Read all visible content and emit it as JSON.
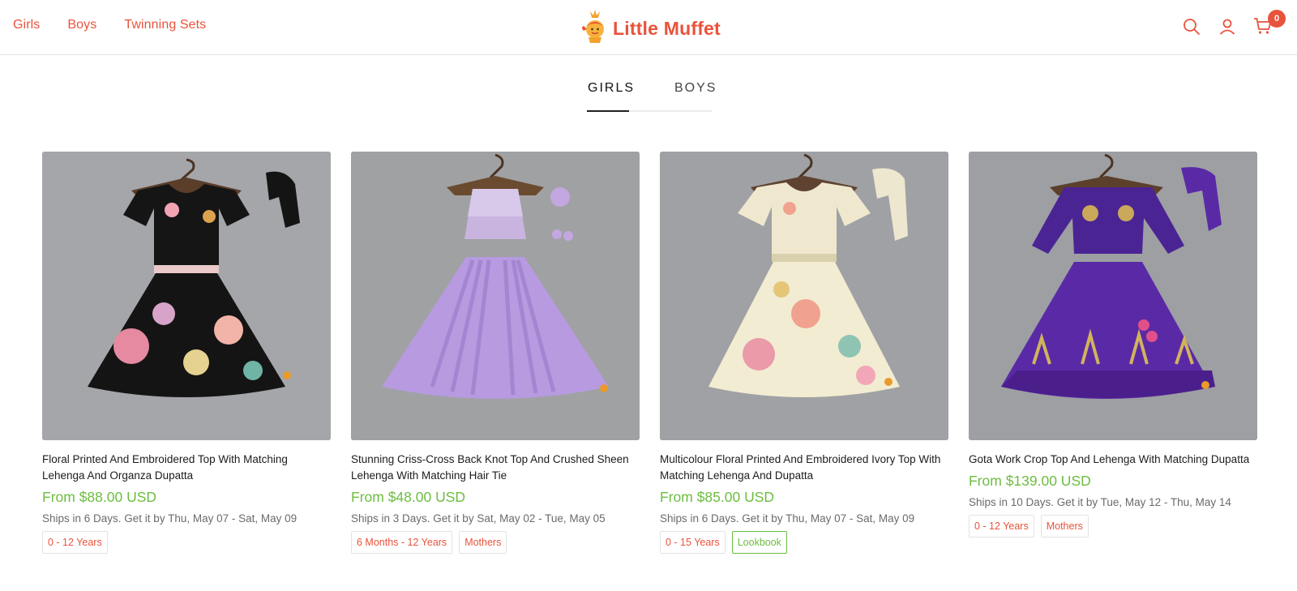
{
  "header": {
    "nav": [
      "Girls",
      "Boys",
      "Twinning Sets"
    ],
    "logo_text": "Little Muffet",
    "cart_count": "0"
  },
  "tabs": [
    {
      "label": "GIRLS",
      "active": true
    },
    {
      "label": "BOYS",
      "active": false
    }
  ],
  "colors": {
    "brand": "#e8533c",
    "price": "#6cbd3f"
  },
  "products": [
    {
      "title": "Floral Printed And Embroidered Top With Matching Lehenga And Organza Dupatta",
      "price": "From $88.00 USD",
      "shipping": "Ships in 6 Days. Get it by Thu, May 07 - Sat, May 09",
      "tags": [
        {
          "label": "0 - 12 Years",
          "style": "orange"
        }
      ]
    },
    {
      "title": "Stunning Criss-Cross Back Knot Top And Crushed Sheen Lehenga With Matching Hair Tie",
      "price": "From $48.00 USD",
      "shipping": "Ships in 3 Days. Get it by Sat, May 02 - Tue, May 05",
      "tags": [
        {
          "label": "6 Months - 12 Years",
          "style": "orange"
        },
        {
          "label": "Mothers",
          "style": "orange"
        }
      ]
    },
    {
      "title": "Multicolour Floral Printed And Embroidered Ivory Top With Matching Lehenga And Dupatta",
      "price": "From $85.00 USD",
      "shipping": "Ships in 6 Days. Get it by Thu, May 07 - Sat, May 09",
      "tags": [
        {
          "label": "0 - 15 Years",
          "style": "orange"
        },
        {
          "label": "Lookbook",
          "style": "green"
        }
      ]
    },
    {
      "title": "Gota Work Crop Top And Lehenga With Matching Dupatta",
      "price": "From $139.00 USD",
      "shipping": "Ships in 10 Days. Get it by Tue, May 12 - Thu, May 14",
      "tags": [
        {
          "label": "0 - 12 Years",
          "style": "orange"
        },
        {
          "label": "Mothers",
          "style": "orange"
        }
      ]
    }
  ]
}
